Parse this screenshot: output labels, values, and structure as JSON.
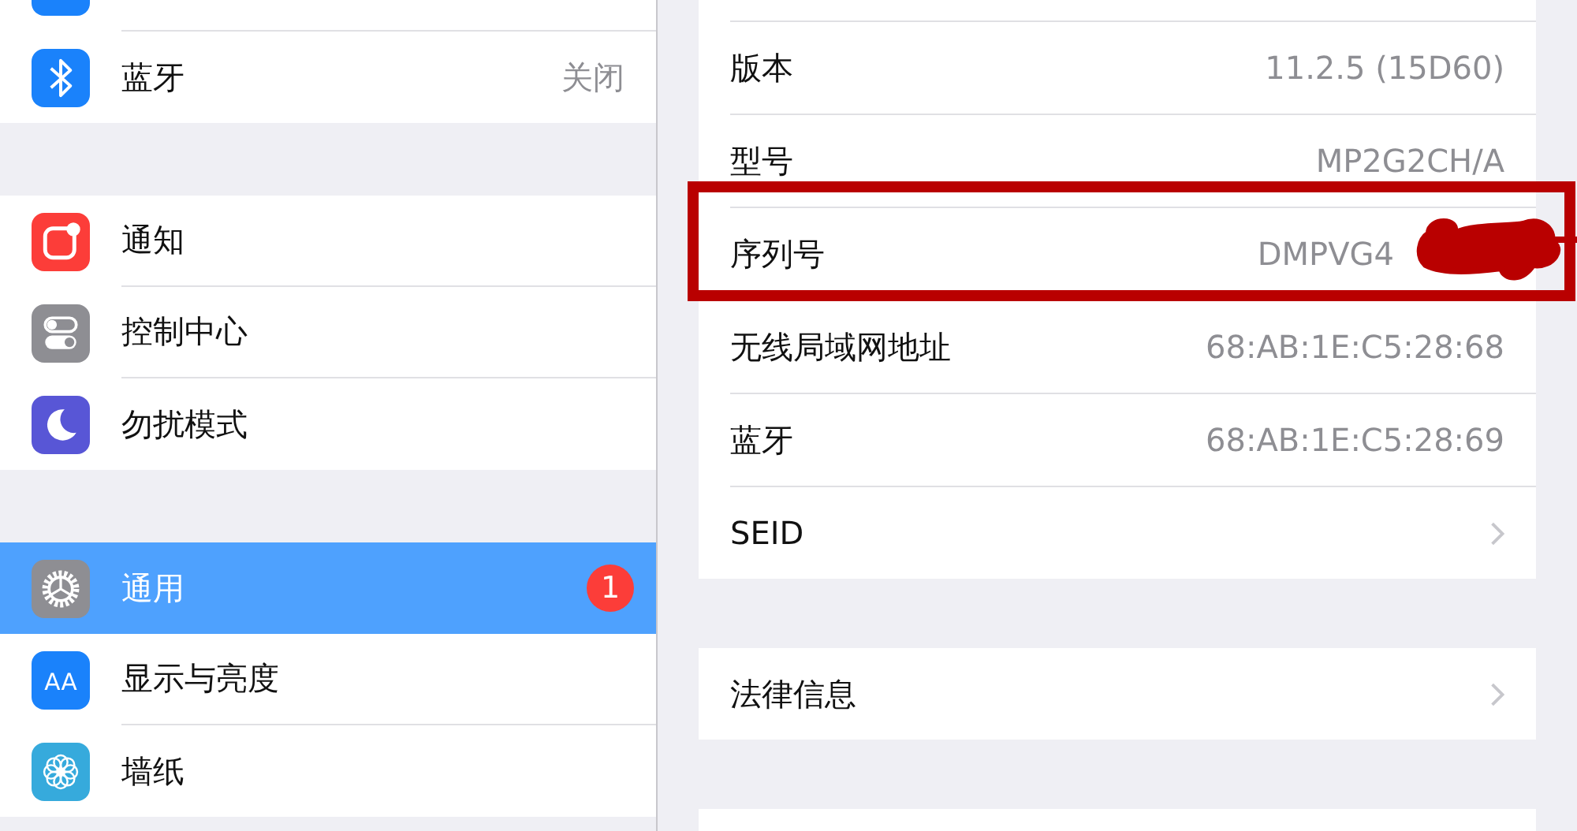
{
  "sidebar": {
    "groups": [
      {
        "rows": [
          {
            "label": "",
            "kind": "generic",
            "color": "#1a82fb",
            "selected": false
          },
          {
            "label": "蓝牙",
            "value": "关闭",
            "kind": "bluetooth",
            "color": "#1a82fb",
            "selected": false
          }
        ]
      },
      {
        "rows": [
          {
            "label": "通知",
            "kind": "notifications",
            "color": "#fc3d39",
            "selected": false
          },
          {
            "label": "控制中心",
            "kind": "switches",
            "color": "#8e8e93",
            "selected": false
          },
          {
            "label": "勿扰模式",
            "kind": "moon",
            "color": "#5856d6",
            "selected": false
          }
        ]
      },
      {
        "rows": [
          {
            "label": "通用",
            "badge": "1",
            "kind": "gear",
            "color": "#8e8e93",
            "selected": true
          },
          {
            "label": "显示与亮度",
            "kind": "text",
            "icon_text": "AA",
            "color": "#1a82fb",
            "selected": false
          },
          {
            "label": "墙纸",
            "kind": "flower",
            "color": "#36aadc",
            "selected": false
          }
        ]
      }
    ]
  },
  "detail": {
    "groups": [
      {
        "rows": [
          {
            "label": "版本",
            "value": "11.2.5 (15D60)",
            "chevron": false
          },
          {
            "label": "型号",
            "value": "MP2G2CH/A",
            "chevron": false
          },
          {
            "label": "序列号",
            "value": "DMPVG4",
            "chevron": false,
            "highlighted": true
          },
          {
            "label": "无线局域网地址",
            "value": "68:AB:1E:C5:28:68",
            "chevron": false
          },
          {
            "label": "蓝牙",
            "value": "68:AB:1E:C5:28:69",
            "chevron": false
          },
          {
            "label": "SEID",
            "chevron": true
          }
        ]
      },
      {
        "rows": [
          {
            "label": "法律信息",
            "chevron": true
          }
        ]
      }
    ]
  }
}
